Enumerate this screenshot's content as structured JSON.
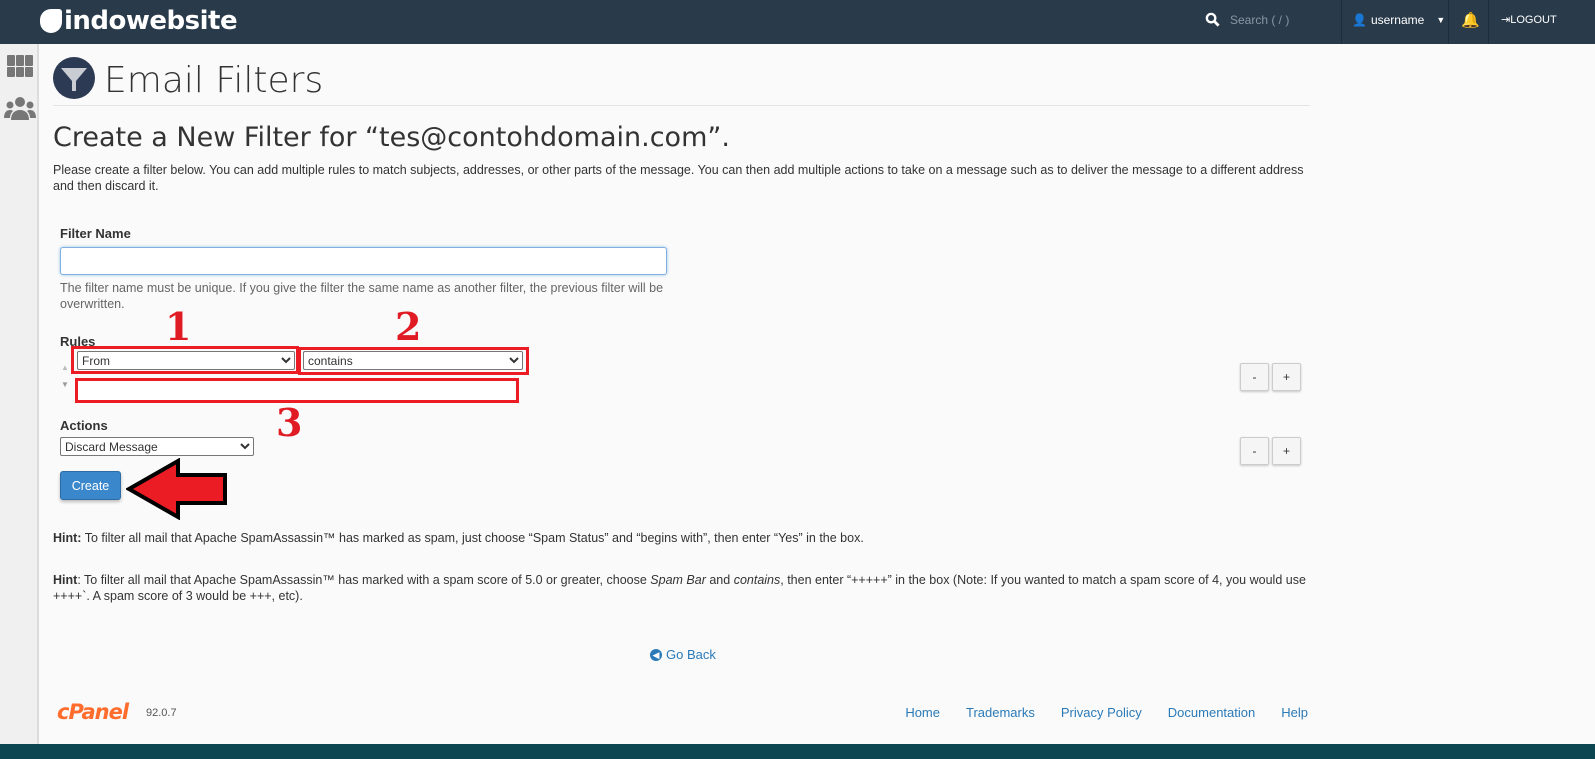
{
  "header": {
    "brand": "indowebsite",
    "search_placeholder": "Search ( / )",
    "username": "username",
    "logout": "LOGOUT"
  },
  "page": {
    "title": "Email Filters",
    "heading": "Create a New Filter for “tes@contohdomain.com”.",
    "description": "Please create a filter below. You can add multiple rules to match subjects, addresses, or other parts of the message. You can then add multiple actions to take on a message such as to deliver the message to a different address and then discard it."
  },
  "form": {
    "filter_name_label": "Filter Name",
    "filter_name_value": "",
    "filter_name_help": "The filter name must be unique. If you give the filter the same name as another filter, the previous filter will be overwritten.",
    "rules_label": "Rules",
    "rule_part": "From",
    "rule_match": "contains",
    "rule_value": "",
    "actions_label": "Actions",
    "action": "Discard Message",
    "minus": "-",
    "plus": "+",
    "create": "Create"
  },
  "annotations": {
    "one": "1",
    "two": "2",
    "three": "3",
    "highlight_color": "#ec1c24"
  },
  "hints": {
    "hint1_label": "Hint:",
    "hint1": " To filter all mail that Apache SpamAssassin™ has marked as spam, just choose “Spam Status” and “begins with”, then enter “Yes” in the box.",
    "hint2_label": "Hint",
    "hint2_a": ": To filter all mail that Apache SpamAssassin™ has marked with a spam score of 5.0 or greater, choose ",
    "hint2_b": "Spam Bar",
    "hint2_c": " and ",
    "hint2_d": "contains",
    "hint2_e": ", then enter “+++++” in the box (Note: If you wanted to match a spam score of 4, you would use ++++`. A spam score of 3 would be +++, etc)."
  },
  "go_back": "Go Back",
  "footer": {
    "logo": "cPanel",
    "version": "92.0.7",
    "links": [
      "Home",
      "Trademarks",
      "Privacy Policy",
      "Documentation",
      "Help"
    ]
  },
  "colors": {
    "topbar": "#293a4a",
    "primary": "#3a87cc",
    "cpanel": "#ff6c2c"
  }
}
